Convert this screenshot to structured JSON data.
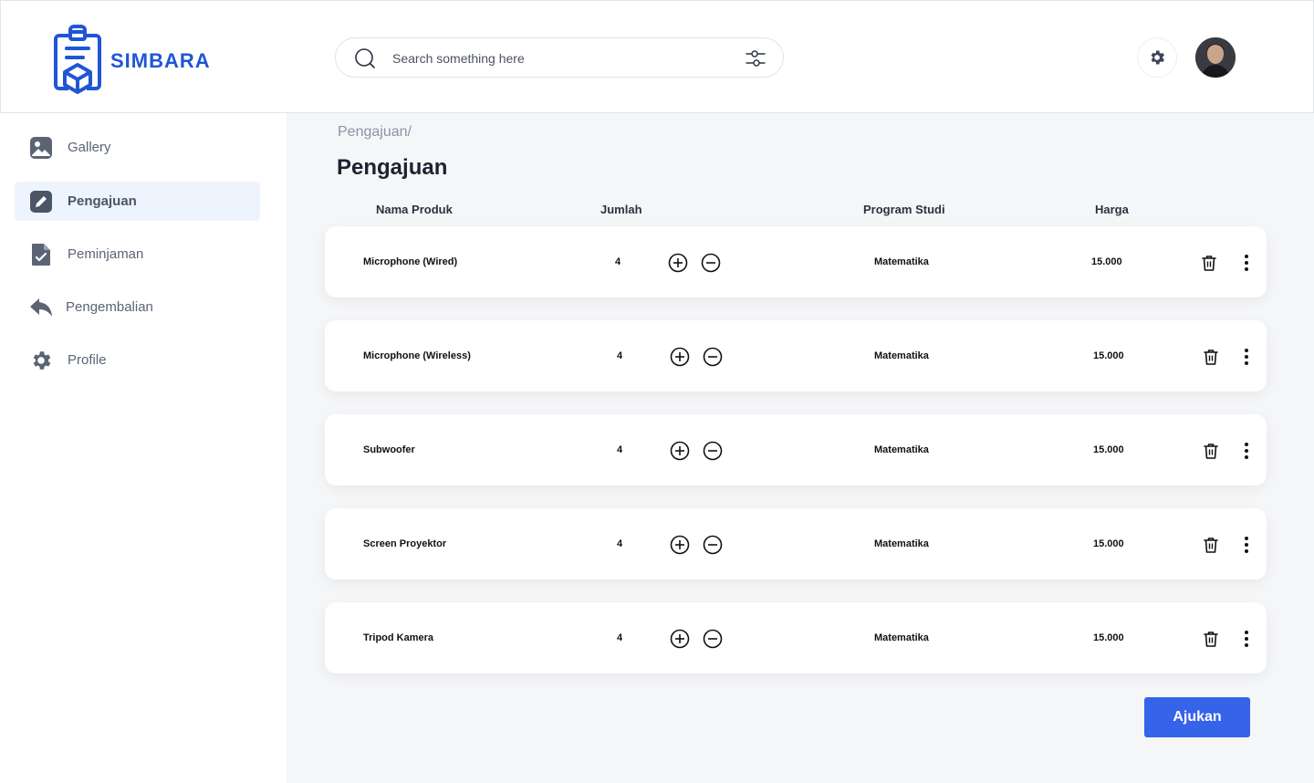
{
  "app": {
    "brand": "SIMBARA",
    "brand_color": "#1f56d6",
    "accent_color": "#3563e9"
  },
  "search": {
    "placeholder": "Search something here"
  },
  "sidebar": {
    "items": [
      {
        "label": "Gallery",
        "icon": "gallery-icon",
        "active": false
      },
      {
        "label": "Pengajuan",
        "icon": "edit-icon",
        "active": true
      },
      {
        "label": "Peminjaman",
        "icon": "document-check-icon",
        "active": false
      },
      {
        "label": "Pengembalian",
        "icon": "reply-icon",
        "active": false
      },
      {
        "label": "Profile",
        "icon": "gear-icon",
        "active": false
      }
    ]
  },
  "main": {
    "breadcrumb": "Pengajuan/",
    "title": "Pengajuan",
    "columns": {
      "name": "Nama Produk",
      "qty": "Jumlah",
      "program": "Program Studi",
      "price": "Harga"
    },
    "rows": [
      {
        "name": "Microphone (Wired)",
        "qty": "4",
        "program": "Matematika",
        "price": "15.000"
      },
      {
        "name": "Microphone (Wireless)",
        "qty": "4",
        "program": "Matematika",
        "price": "15.000"
      },
      {
        "name": "Subwoofer",
        "qty": "4",
        "program": "Matematika",
        "price": "15.000"
      },
      {
        "name": "Screen Proyektor",
        "qty": "4",
        "program": "Matematika",
        "price": "15.000"
      },
      {
        "name": "Tripod Kamera",
        "qty": "4",
        "program": "Matematika",
        "price": "15.000"
      }
    ],
    "submit_label": "Ajukan"
  }
}
